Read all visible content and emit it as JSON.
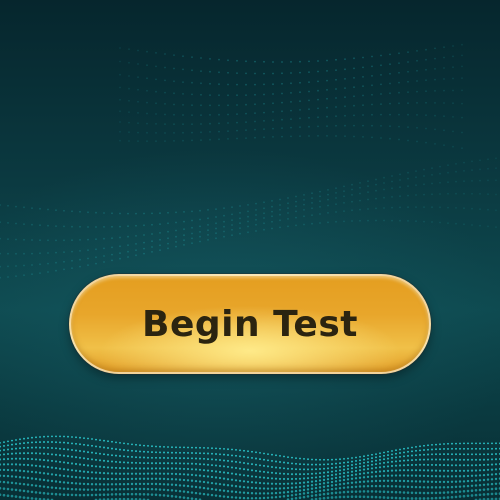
{
  "screen": {
    "background_top": "#06262d",
    "background_mid": "#0e4a50",
    "particle_color": "#2fd9df"
  },
  "start_button": {
    "label": "Begin Test",
    "color": "#e8a62b",
    "text_color": "#2b2410"
  }
}
